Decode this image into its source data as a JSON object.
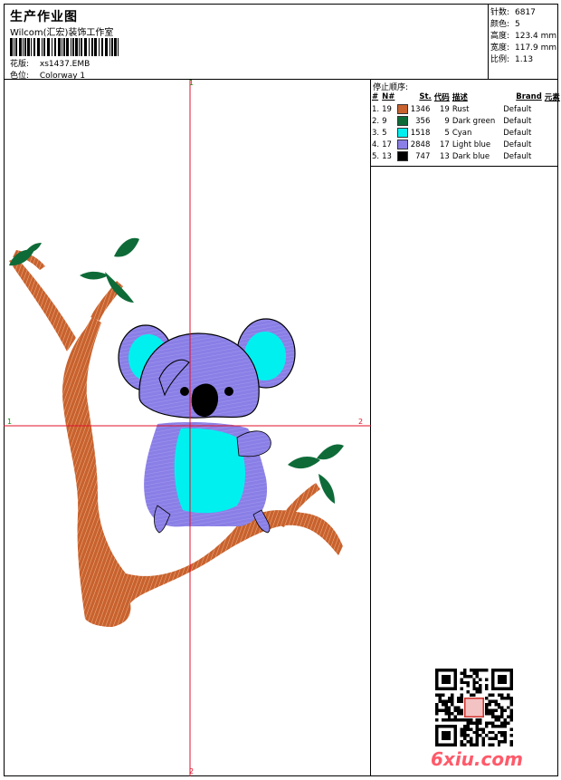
{
  "header": {
    "title": "生产作业图",
    "company": "Wilcom(汇宏)装饰工作室",
    "pattern_label": "花版:",
    "pattern_value": "xs1437.EMB",
    "colorway_label": "色位:",
    "colorway_value": "Colorway 1"
  },
  "stats": [
    {
      "label": "针数:",
      "value": "6817"
    },
    {
      "label": "颜色:",
      "value": "5"
    },
    {
      "label": "高度:",
      "value": "123.4 mm"
    },
    {
      "label": "宽度:",
      "value": "117.9 mm"
    },
    {
      "label": "比例:",
      "value": "1.13"
    }
  ],
  "stop_sequence": {
    "title": "停止顺序:",
    "columns": [
      "#",
      "N#",
      "St.",
      "代码",
      "描述",
      "Brand",
      "元素"
    ],
    "rows": [
      {
        "idx": "1.",
        "n": "19",
        "color": "#c8622e",
        "st": "1346",
        "code": "19",
        "desc": "Rust",
        "brand": "Default"
      },
      {
        "idx": "2.",
        "n": "9",
        "color": "#0e6b38",
        "st": "356",
        "code": "9",
        "desc": "Dark green",
        "brand": "Default"
      },
      {
        "idx": "3.",
        "n": "5",
        "color": "#00f0f0",
        "st": "1518",
        "code": "5",
        "desc": "Cyan",
        "brand": "Default"
      },
      {
        "idx": "4.",
        "n": "17",
        "color": "#8a7fe6",
        "st": "2848",
        "code": "17",
        "desc": "Light blue",
        "brand": "Default"
      },
      {
        "idx": "5.",
        "n": "13",
        "color": "#000000",
        "st": "747",
        "code": "13",
        "desc": "Dark blue",
        "brand": "Default"
      }
    ]
  },
  "axis_labels": {
    "top": "1",
    "left": "1",
    "right": "2",
    "bottom": "2"
  },
  "logo_text": "6xiu.com",
  "colors": {
    "rust": "#c8622e",
    "green": "#0e6b38",
    "cyan": "#00f0f0",
    "lightblue": "#8a7fe6",
    "black": "#000000",
    "crosshair": "#e0102a"
  }
}
